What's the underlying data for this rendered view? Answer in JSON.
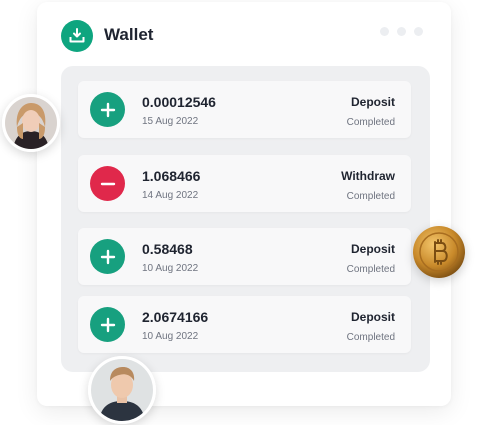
{
  "header": {
    "title": "Wallet",
    "logo_icon": "wallet-download-icon",
    "accent_color": "#0ea57f"
  },
  "transactions": [
    {
      "amount": "0.00012546",
      "date": "15 Aug 2022",
      "type": "Deposit",
      "status": "Completed",
      "icon": "plus-icon"
    },
    {
      "amount": "1.068466",
      "date": "14 Aug 2022",
      "type": "Withdraw",
      "status": "Completed",
      "icon": "minus-icon"
    },
    {
      "amount": "0.58468",
      "date": "10 Aug 2022",
      "type": "Deposit",
      "status": "Completed",
      "icon": "plus-icon"
    },
    {
      "amount": "2.0674166",
      "date": "10 Aug 2022",
      "type": "Deposit",
      "status": "Completed",
      "icon": "plus-icon"
    }
  ],
  "colors": {
    "deposit": "#17a07f",
    "withdraw": "#e0284b"
  },
  "decorations": {
    "avatar_top": "user-avatar",
    "avatar_bottom": "user-avatar",
    "coin": "bitcoin-coin-icon"
  }
}
